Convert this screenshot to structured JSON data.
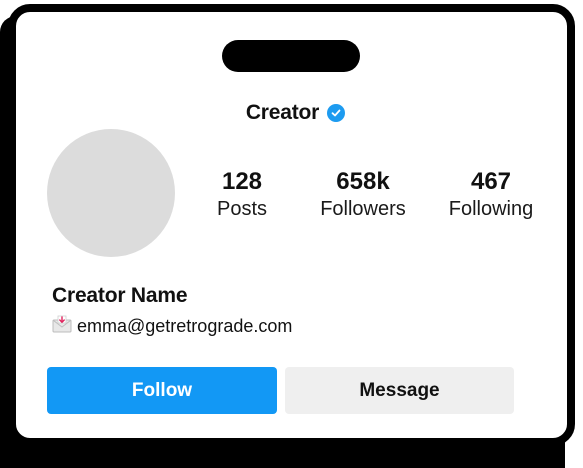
{
  "profile": {
    "username": "Creator",
    "display_name": "Creator Name",
    "email": "emma@getretrograde.com"
  },
  "stats": [
    {
      "value": "128",
      "label": "Posts"
    },
    {
      "value": "658k",
      "label": "Followers"
    },
    {
      "value": "467",
      "label": "Following"
    }
  ],
  "actions": {
    "follow_label": "Follow",
    "message_label": "Message"
  },
  "icons": {
    "verified": "verified-badge-icon",
    "email": "envelope-icon"
  },
  "colors": {
    "accent": "#1298f5",
    "verified": "#1d9bf0",
    "secondary_button": "#efefef",
    "avatar_placeholder": "#dcdcdc"
  }
}
